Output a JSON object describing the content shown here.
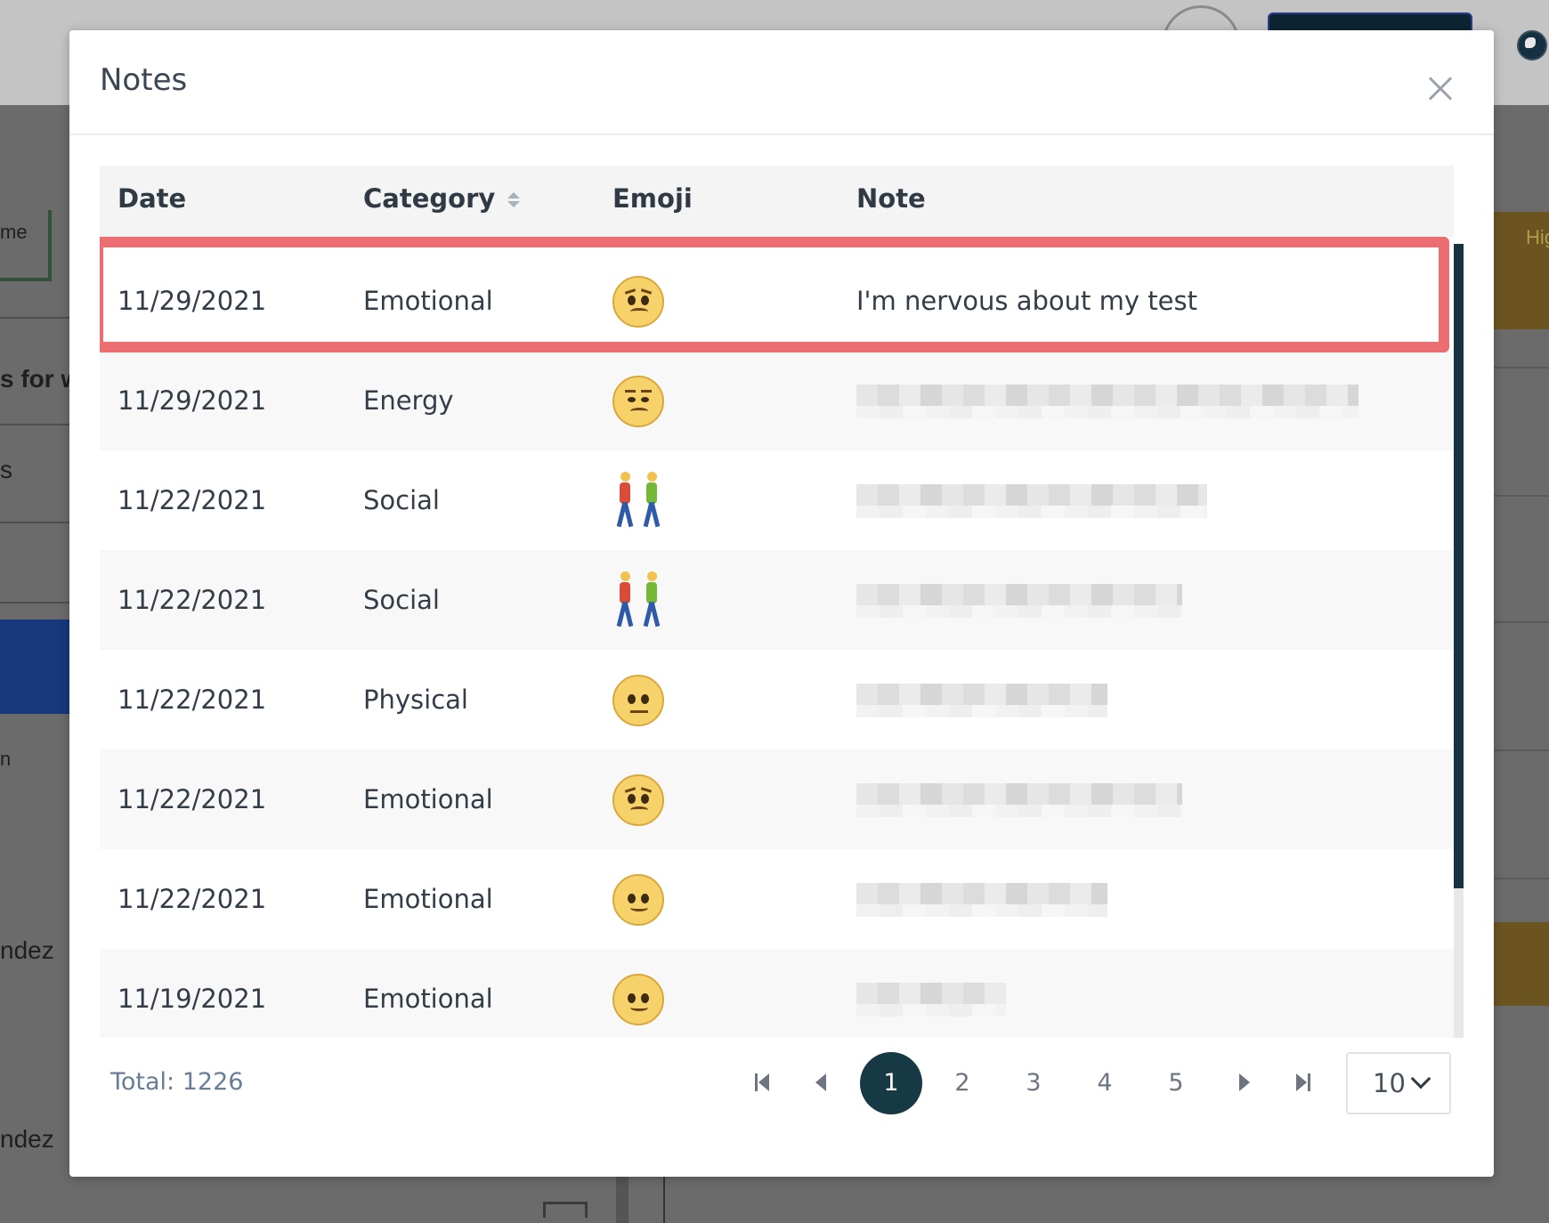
{
  "background": {
    "fragments": [
      "me",
      "s for w",
      "s",
      "n",
      "ndez",
      "ndez",
      "Hig"
    ]
  },
  "modal": {
    "title": "Notes",
    "columns": {
      "date": "Date",
      "category": "Category",
      "emoji": "Emoji",
      "note": "Note"
    },
    "rows": [
      {
        "date": "11/29/2021",
        "category": "Emotional",
        "emoji": "worried-face-icon",
        "note": "I'm nervous about my test"
      },
      {
        "date": "11/29/2021",
        "category": "Energy",
        "emoji": "unamused-face-icon",
        "note": ""
      },
      {
        "date": "11/22/2021",
        "category": "Social",
        "emoji": "people-walking-icon",
        "note": ""
      },
      {
        "date": "11/22/2021",
        "category": "Social",
        "emoji": "people-walking-icon",
        "note": ""
      },
      {
        "date": "11/22/2021",
        "category": "Physical",
        "emoji": "neutral-face-icon",
        "note": ""
      },
      {
        "date": "11/22/2021",
        "category": "Emotional",
        "emoji": "worried-face-icon",
        "note": ""
      },
      {
        "date": "11/22/2021",
        "category": "Emotional",
        "emoji": "slight-smile-face-icon",
        "note": ""
      },
      {
        "date": "11/19/2021",
        "category": "Emotional",
        "emoji": "slight-smile-face-icon",
        "note": ""
      }
    ],
    "selected_row": 0,
    "total": "Total: 1226",
    "pagination": {
      "pages": [
        "1",
        "2",
        "3",
        "4",
        "5"
      ],
      "current": "1",
      "per_page": "10"
    }
  },
  "colors": {
    "highlight": "#ec6d72",
    "active_page": "#173845",
    "scroll_thumb": "#153340",
    "total_text": "#6a7d97"
  }
}
